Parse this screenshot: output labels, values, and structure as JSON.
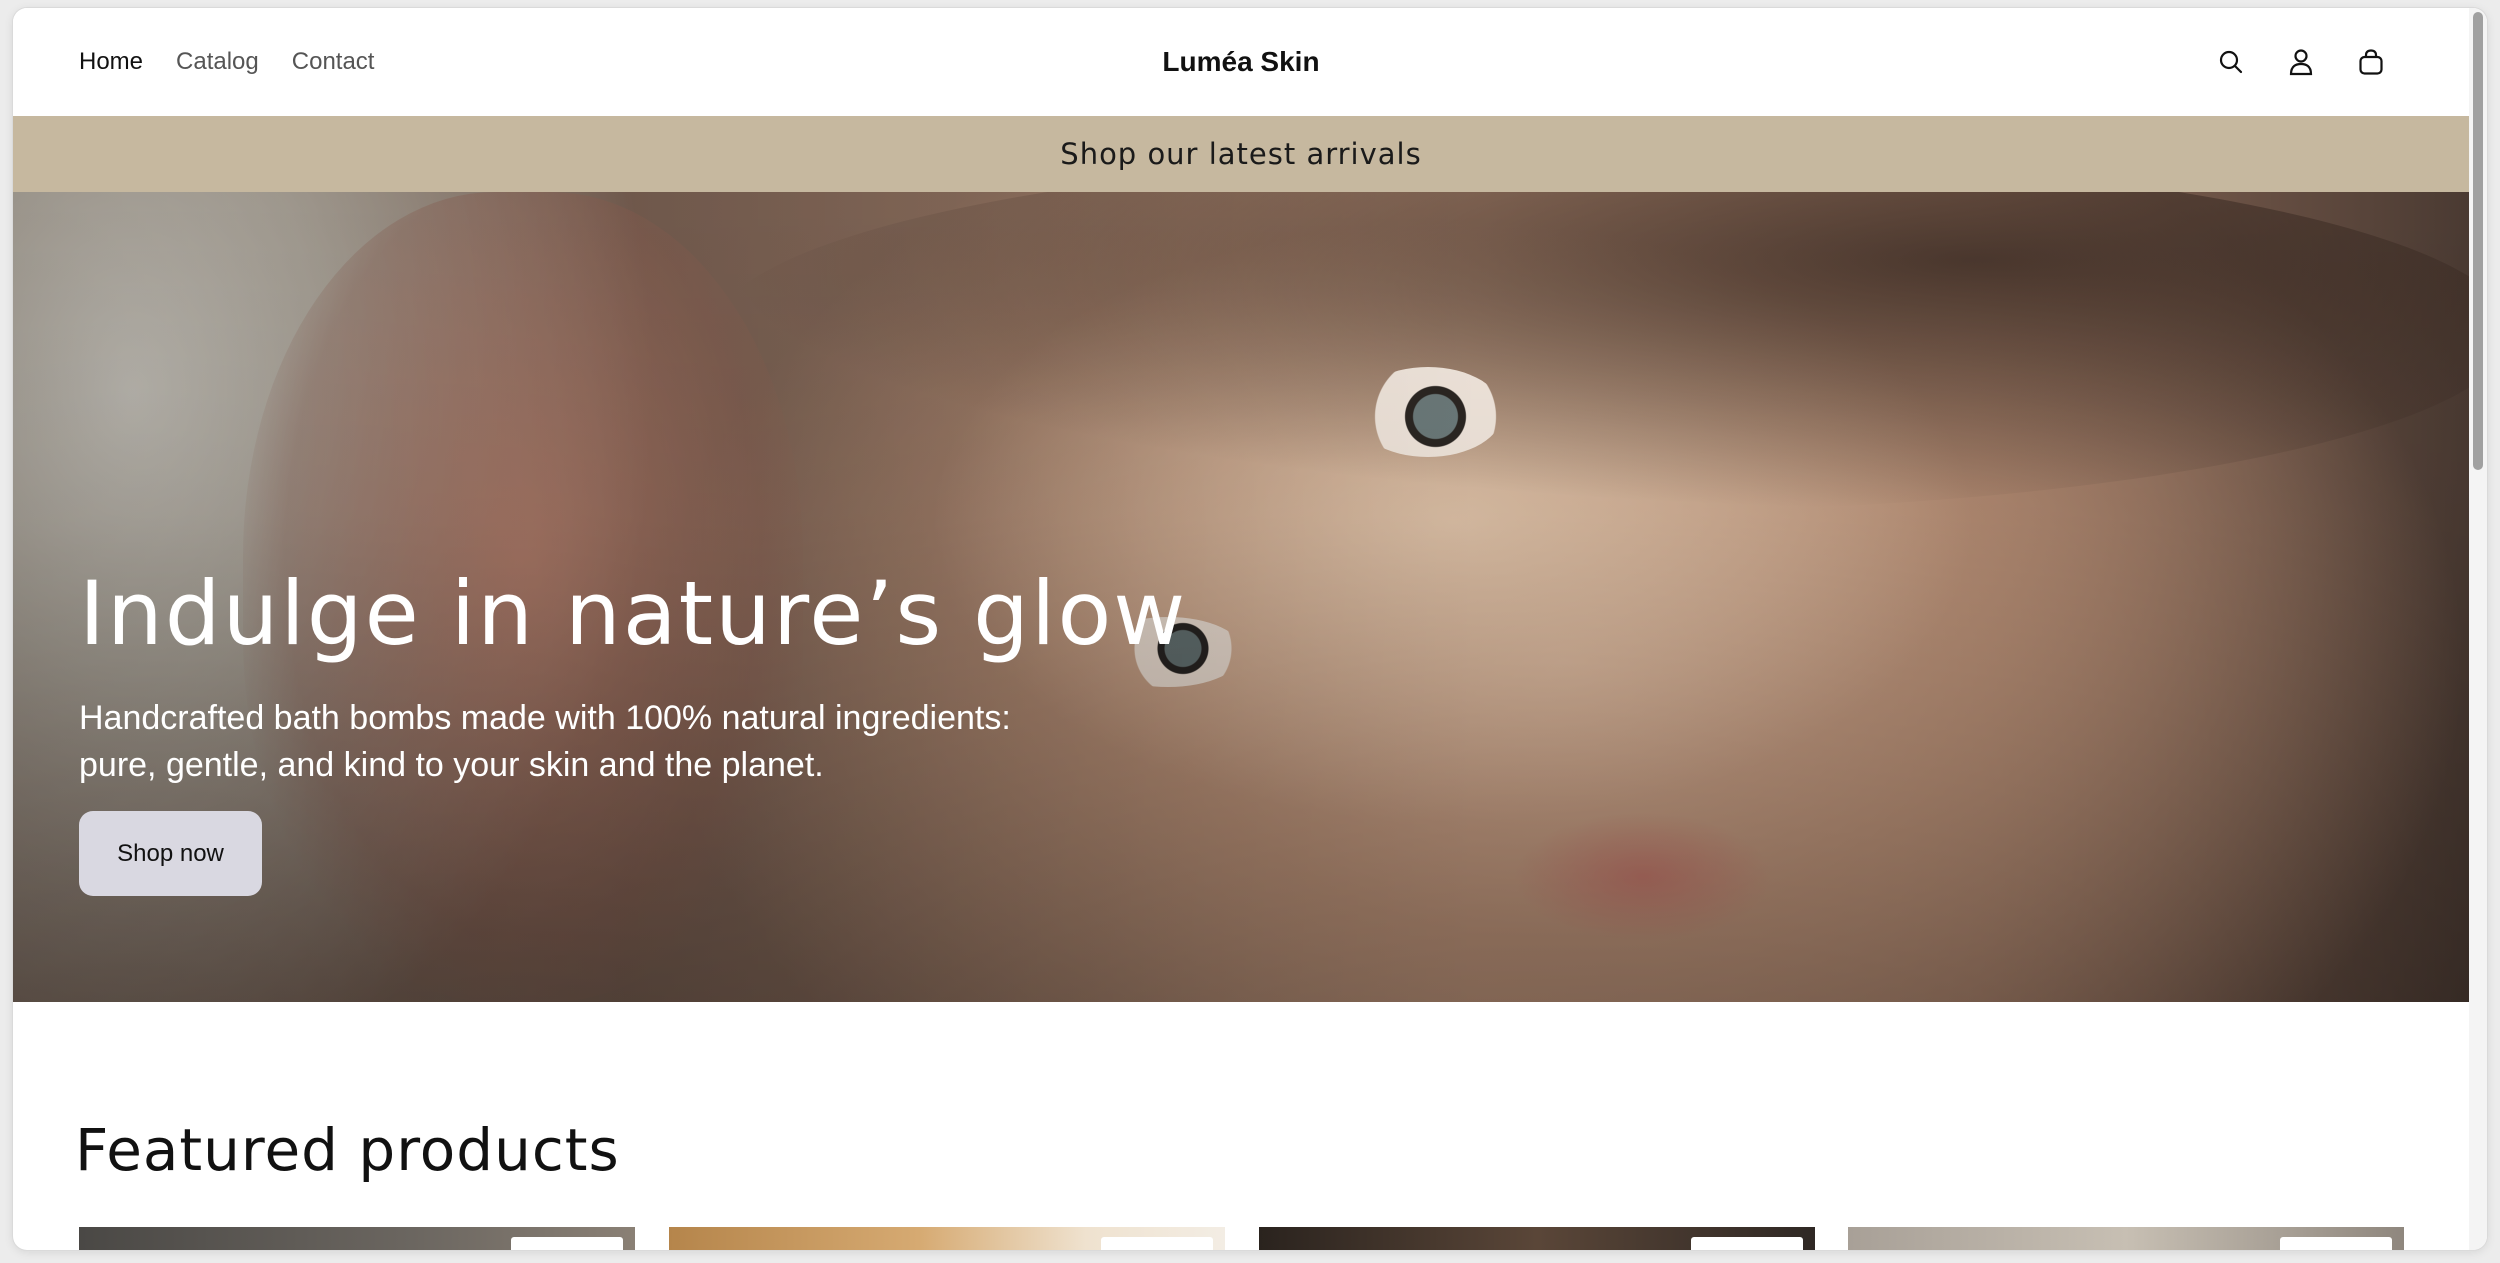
{
  "header": {
    "nav": [
      "Home",
      "Catalog",
      "Contact"
    ],
    "active_nav": "Home",
    "brand": "Luméa Skin",
    "icons": [
      "search-icon",
      "account-icon",
      "cart-icon"
    ]
  },
  "announcement": {
    "text": "Shop our latest arrivals"
  },
  "hero": {
    "title": "Indulge in nature’s glow",
    "subtitle": "Handcrafted bath bombs made with 100% natural ingredients: pure, gentle, and kind to your skin and the planet.",
    "button_label": "Shop now"
  },
  "featured": {
    "title": "Featured products"
  },
  "colors": {
    "announcement_bg": "#c6b89f",
    "button_bg": "#d9d8e1",
    "text_dark": "#111111",
    "nav_text": "#555555"
  }
}
